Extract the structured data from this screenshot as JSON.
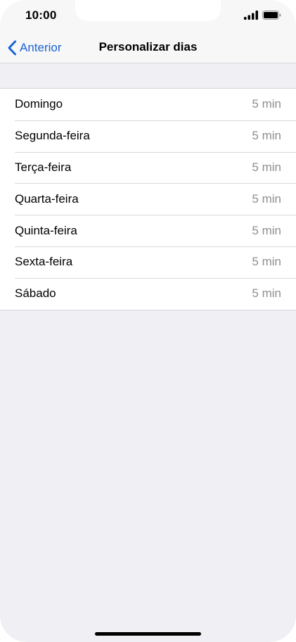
{
  "status_bar": {
    "time": "10:00",
    "signal_icon": "cellular-signal-icon",
    "battery_icon": "battery-icon"
  },
  "nav": {
    "back_label": "Anterior",
    "back_icon": "chevron-left-icon",
    "title": "Personalizar dias",
    "accent_color": "#1a63d6"
  },
  "days": [
    {
      "label": "Domingo",
      "value": "5 min"
    },
    {
      "label": "Segunda-feira",
      "value": "5 min"
    },
    {
      "label": "Terça-feira",
      "value": "5 min"
    },
    {
      "label": "Quarta-feira",
      "value": "5 min"
    },
    {
      "label": "Quinta-feira",
      "value": "5 min"
    },
    {
      "label": "Sexta-feira",
      "value": "5 min"
    },
    {
      "label": "Sábado",
      "value": "5 min"
    }
  ]
}
